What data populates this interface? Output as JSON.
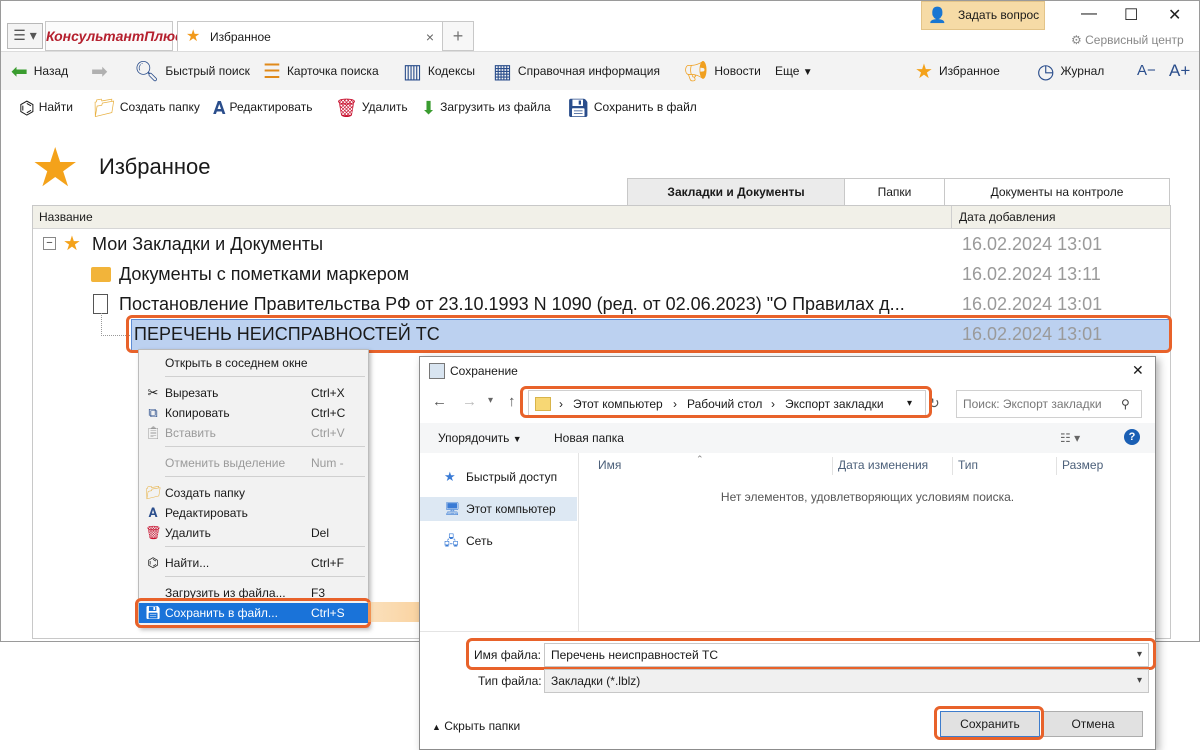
{
  "app": {
    "logo": "КонсультантПлюс",
    "tab_title": "Избранное",
    "tab_close": "×",
    "new_tab": "+",
    "ask_button": "Задать вопрос",
    "service_center": "Сервисный центр",
    "win_min": "—",
    "win_max": "☐",
    "win_close": "✕"
  },
  "nav": {
    "back": "Назад",
    "quick_search": "Быстрый поиск",
    "search_card": "Карточка поиска",
    "codes": "Кодексы",
    "reference": "Справочная информация",
    "news": "Новости",
    "more": "Еще",
    "favorites": "Избранное",
    "journal": "Журнал",
    "font_smaller": "A−",
    "font_bigger": "A+"
  },
  "actions": {
    "find": "Найти",
    "create_folder": "Создать папку",
    "edit": "Редактировать",
    "delete": "Удалить",
    "load": "Загрузить из файла",
    "save": "Сохранить в файл"
  },
  "page": {
    "title": "Избранное",
    "tabs": [
      "Закладки и Документы",
      "Папки",
      "Документы на контроле"
    ]
  },
  "table": {
    "col_name": "Название",
    "col_date": "Дата добавления",
    "rows": [
      {
        "name": "Мои Закладки и Документы",
        "date": "16.02.2024 13:01"
      },
      {
        "name": "Документы с пометками маркером",
        "date": "16.02.2024 13:11"
      },
      {
        "name": "Постановление Правительства РФ от 23.10.1993 N 1090 (ред. от 02.06.2023) \"О Правилах д...",
        "date": "16.02.2024 13:01"
      },
      {
        "name": "ПЕРЕЧЕНЬ НЕИСПРАВНОСТЕЙ ТС",
        "date": "16.02.2024 13:01"
      }
    ]
  },
  "context_menu": {
    "open_adjacent": "Открыть в соседнем окне",
    "cut": {
      "label": "Вырезать",
      "key": "Ctrl+X"
    },
    "copy": {
      "label": "Копировать",
      "key": "Ctrl+C"
    },
    "paste": {
      "label": "Вставить",
      "key": "Ctrl+V"
    },
    "deselect": {
      "label": "Отменить выделение",
      "key": "Num -"
    },
    "create_folder": "Создать папку",
    "edit": "Редактировать",
    "delete": {
      "label": "Удалить",
      "key": "Del"
    },
    "find": {
      "label": "Найти...",
      "key": "Ctrl+F"
    },
    "load": {
      "label": "Загрузить из файла...",
      "key": "F3"
    },
    "save": {
      "label": "Сохранить в файл...",
      "key": "Ctrl+S"
    }
  },
  "dialog": {
    "title": "Сохранение",
    "close": "✕",
    "path": [
      "Этот компьютер",
      "Рабочий стол",
      "Экспорт закладки"
    ],
    "search_placeholder": "Поиск: Экспорт закладки",
    "organize": "Упорядочить",
    "new_folder": "Новая папка",
    "help": "?",
    "nav_items": [
      "Быстрый доступ",
      "Этот компьютер",
      "Сеть"
    ],
    "columns": [
      "Имя",
      "Дата изменения",
      "Тип",
      "Размер"
    ],
    "empty_message": "Нет элементов, удовлетворяющих условиям поиска.",
    "filename_label": "Имя файла:",
    "filename_value": "Перечень неисправностей ТС",
    "filetype_label": "Тип файла:",
    "filetype_value": "Закладки (*.lblz)",
    "hide_folders": "Скрыть папки",
    "save_button": "Сохранить",
    "cancel_button": "Отмена"
  },
  "colors": {
    "highlight": "#e8622a",
    "selection": "#bcd1f0",
    "menu_highlight": "#1a73d9",
    "star": "#f4a21a"
  }
}
